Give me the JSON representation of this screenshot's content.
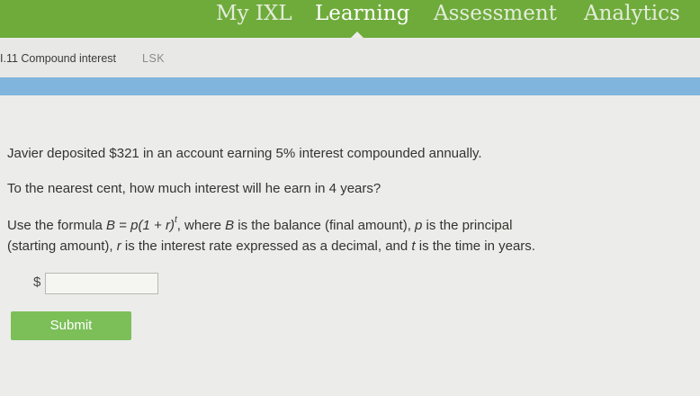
{
  "nav": {
    "items": [
      "My IXL",
      "Learning",
      "Assessment",
      "Analytics"
    ],
    "active": "Learning"
  },
  "skill": {
    "code": "I.11 Compound interest",
    "id": "LSK"
  },
  "question": {
    "line1": "Javier deposited $321 in an account earning 5% interest compounded annually.",
    "line2": "To the nearest cent, how much interest will he earn in 4 years?",
    "formula_prefix": "Use the formula ",
    "formula_lhs": "B",
    "formula_eq": " = ",
    "formula_rhs": "p(1 + r)",
    "formula_exp": "t",
    "formula_suffix": ", where ",
    "var_b": "B",
    "desc_b": " is the balance (final amount), ",
    "var_p": "p",
    "desc_p": " is the principal",
    "line4_start": "(starting amount), ",
    "var_r": "r",
    "desc_r": " is the interest rate expressed as a decimal, and ",
    "var_t": "t",
    "desc_t": " is the time in years."
  },
  "answer": {
    "currency": "$",
    "value": "",
    "placeholder": ""
  },
  "submit": {
    "label": "Submit"
  },
  "colors": {
    "nav_bg": "#6eab3b",
    "progress": "#80b5dd",
    "submit_bg": "#7cbf59"
  }
}
